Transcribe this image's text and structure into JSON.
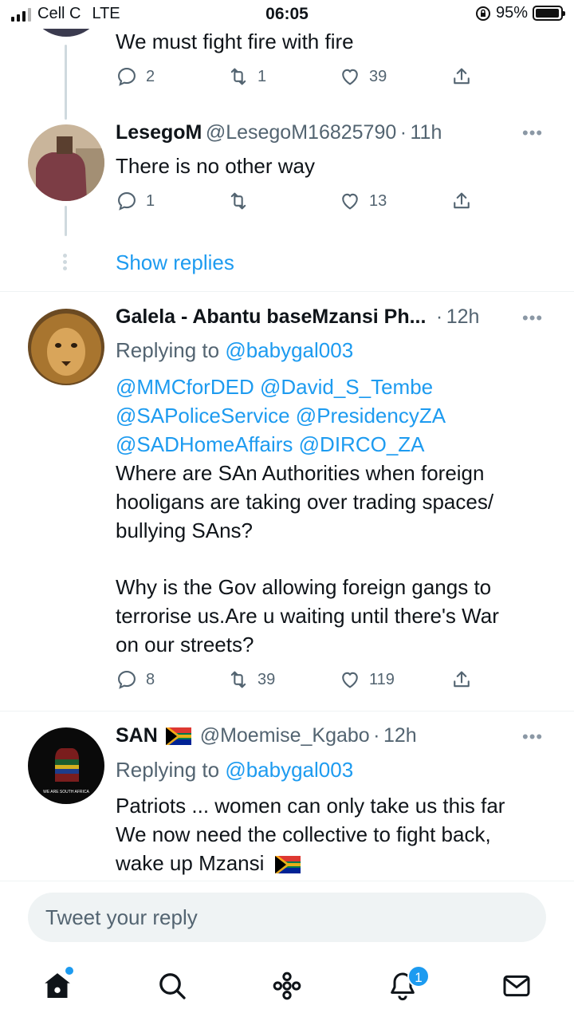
{
  "status_bar": {
    "carrier": "Cell C",
    "network": "LTE",
    "time": "06:05",
    "battery": "95%",
    "battery_level": 0.95
  },
  "tweets": [
    {
      "text": "We must fight fire with fire",
      "replies": "2",
      "retweets": "1",
      "likes": "39"
    },
    {
      "name": "LesegoM",
      "handle": "@LesegoM16825790",
      "sep": "·",
      "time": "11h",
      "text": "There is no other way",
      "replies": "1",
      "retweets": "",
      "likes": "13",
      "show_replies": "Show replies"
    },
    {
      "name": "Galela - Abantu baseMzansi Ph...",
      "sep": "·",
      "time": "12h",
      "replying_prefix": "Replying to",
      "replying_to": "@babygal003",
      "mentions": [
        "@MMCforDED @David_S_Tembe",
        "@SAPoliceService @PresidencyZA",
        "@SADHomeAffairs @DIRCO_ZA"
      ],
      "text_lines": [
        "Where are SAn Authorities when foreign",
        "hooligans are taking over trading spaces/",
        "bullying SAns?",
        "",
        "Why is the Gov allowing foreign gangs to",
        "terrorise us.Are u waiting until there's War",
        "on our streets?"
      ],
      "replies": "8",
      "retweets": "39",
      "likes": "119"
    },
    {
      "name": "SAN",
      "handle": "@Moemise_Kgabo",
      "sep": "·",
      "time": "12h",
      "replying_prefix": "Replying to",
      "replying_to": "@babygal003",
      "avatar_caption": "WE ARE SOUTH AFRICA",
      "text_lines": [
        "Patriots ... women can only take us this far",
        "We now need the collective to fight back,",
        "wake up Mzansi"
      ]
    }
  ],
  "reply_box": {
    "placeholder": "Tweet your reply"
  },
  "tabbar": {
    "notifications_badge": "1"
  },
  "colors": {
    "accent": "#1d9bf0",
    "muted": "#536471",
    "divider": "#eff3f4"
  }
}
